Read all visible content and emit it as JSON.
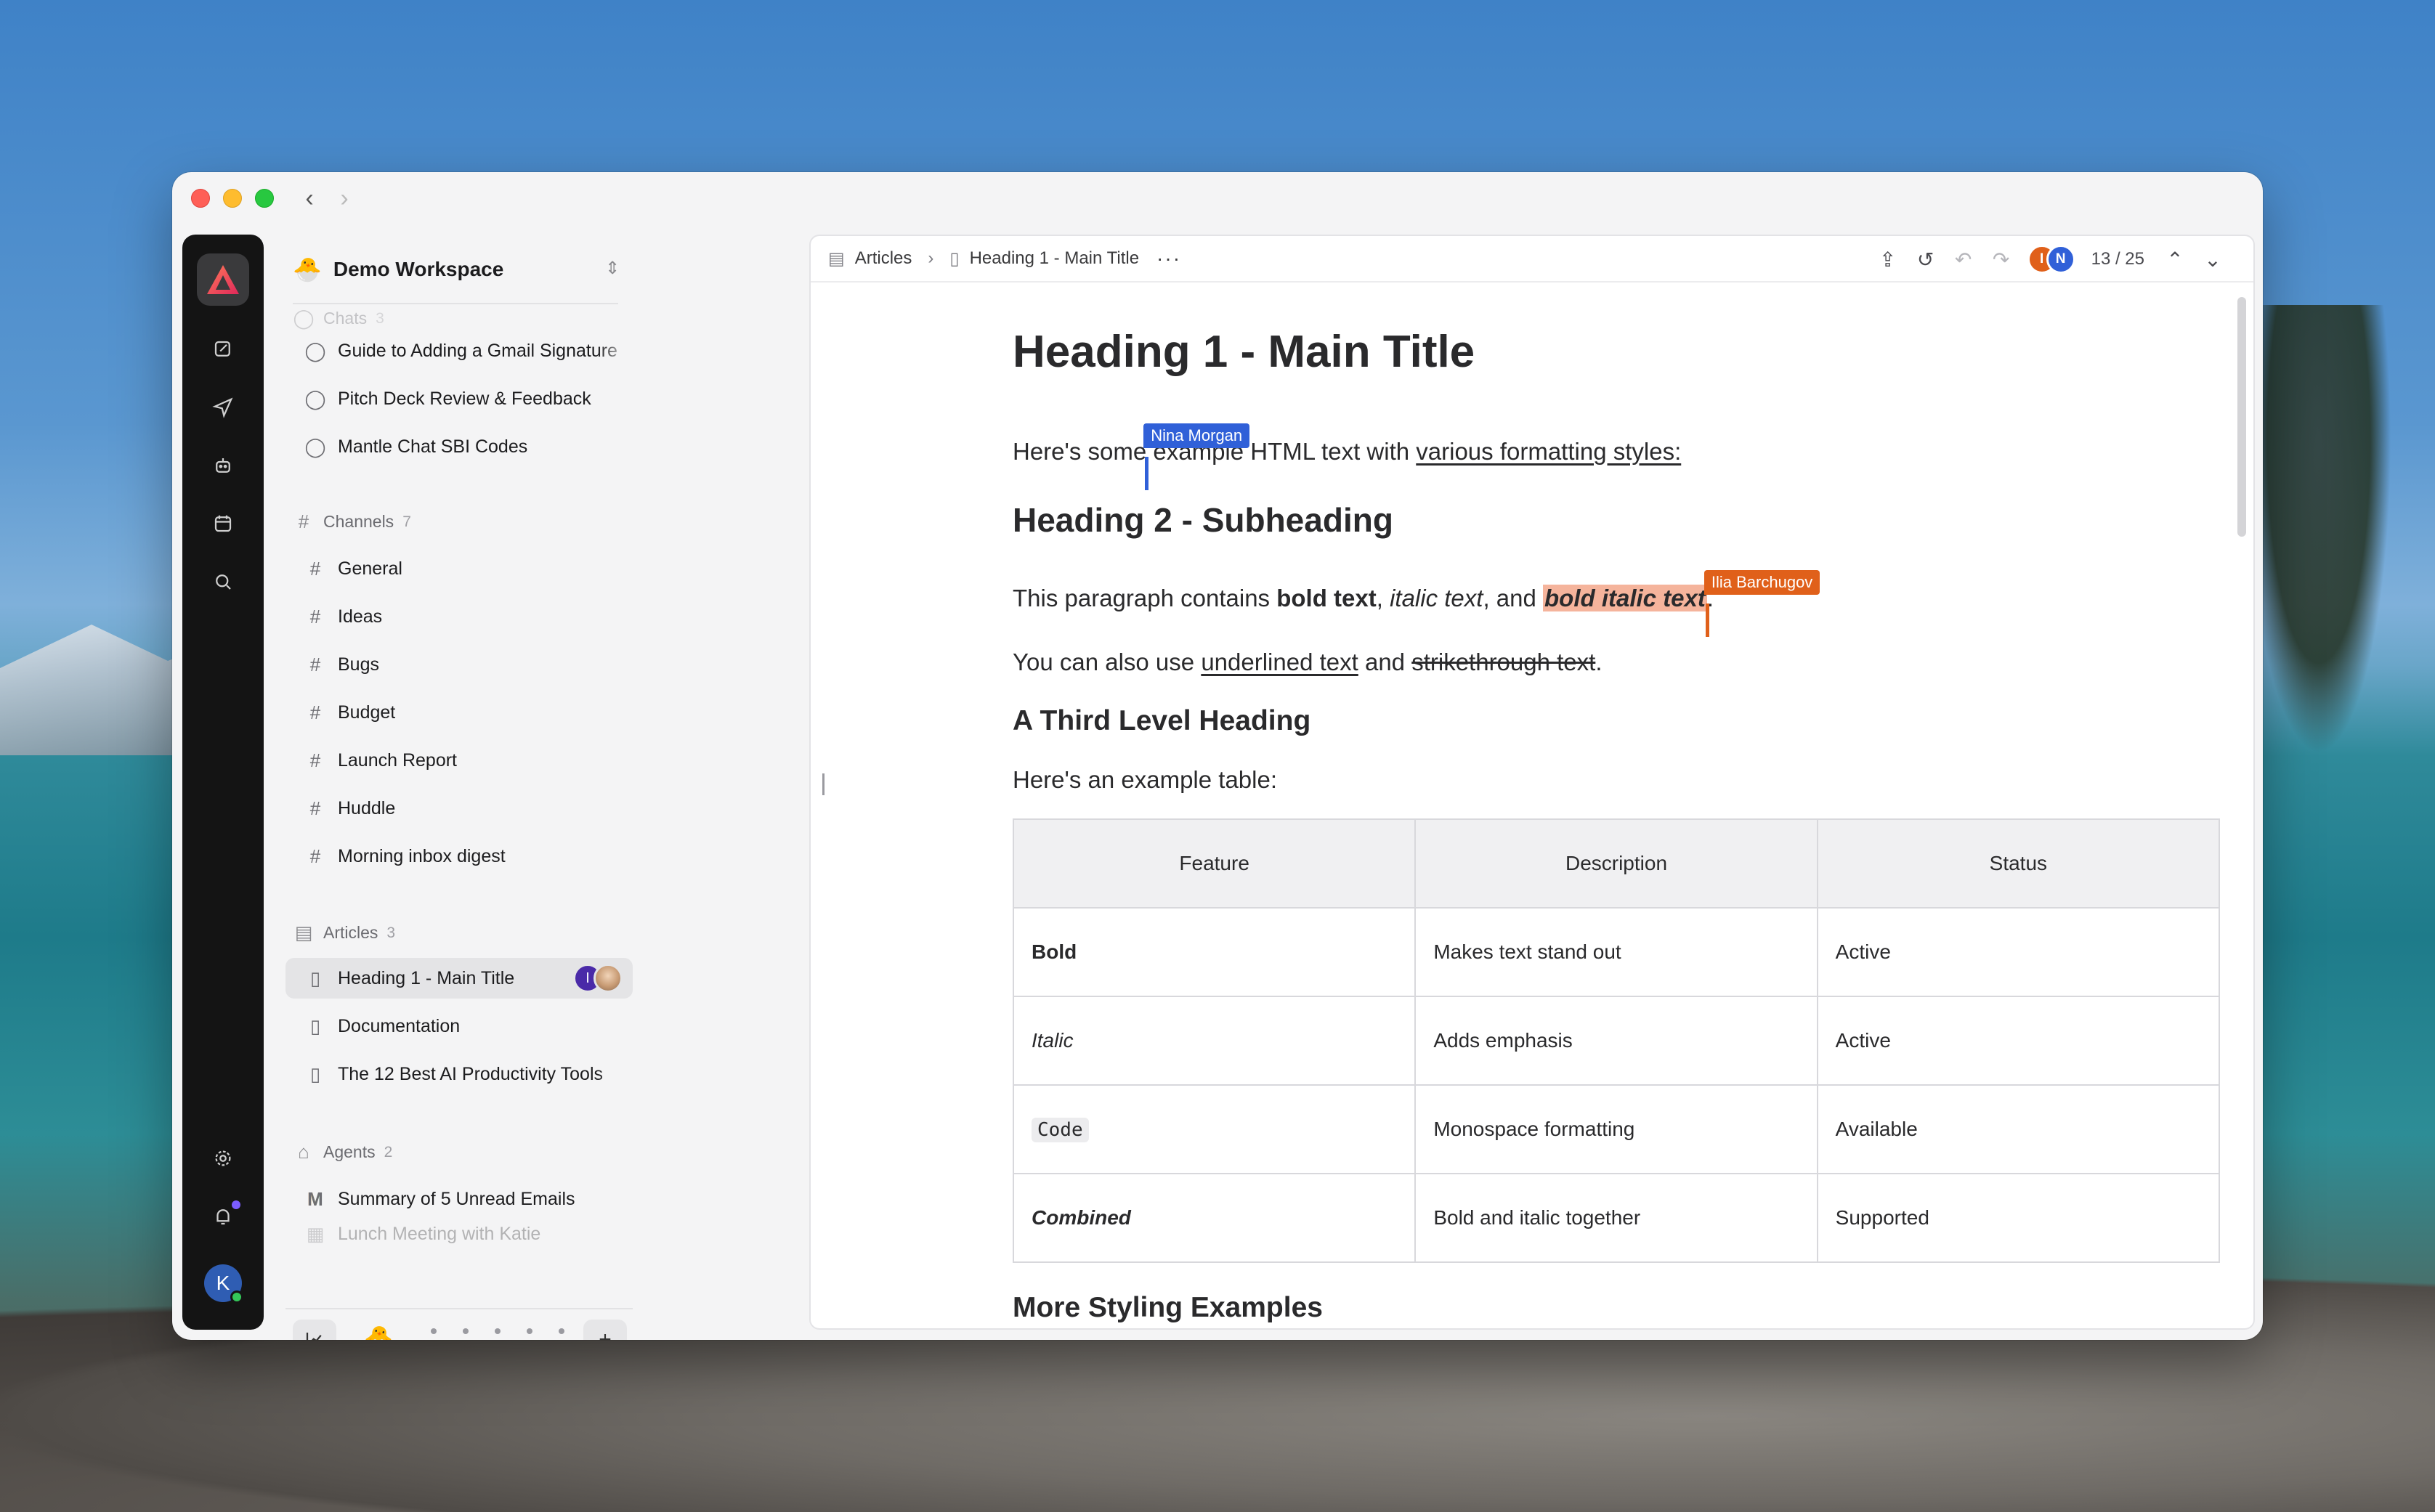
{
  "window": {
    "back_icon": "chevron-left-icon",
    "forward_icon": "chevron-right-icon"
  },
  "workspace": {
    "emoji": "🐣",
    "name": "Demo Workspace"
  },
  "sections": {
    "chats": {
      "label": "Chats",
      "count": "3",
      "items": [
        "Guide to Adding a Gmail Signature",
        "Pitch Deck Review & Feedback",
        "Mantle Chat SBI Codes"
      ]
    },
    "channels": {
      "label": "Channels",
      "count": "7",
      "items": [
        "General",
        "Ideas",
        "Bugs",
        "Budget",
        "Launch Report",
        "Huddle",
        "Morning inbox digest"
      ]
    },
    "articles": {
      "label": "Articles",
      "count": "3",
      "items": [
        "Heading 1 - Main Title",
        "Documentation",
        "The 12 Best AI Productivity Tools"
      ]
    },
    "agents": {
      "label": "Agents",
      "count": "2",
      "items": [
        "Summary of 5 Unread Emails",
        "Lunch Meeting with Katie"
      ]
    }
  },
  "user": {
    "initial": "K"
  },
  "article_presence": {
    "initial": "I"
  },
  "breadcrumb": {
    "root": "Articles",
    "current": "Heading 1 - Main Title"
  },
  "toolbar": {
    "presence_1": "I",
    "presence_2": "N",
    "page_count": "13 / 25"
  },
  "doc": {
    "h1": "Heading 1 - Main Title",
    "p1_a": "Here's some",
    "p1_b": " example HTML text with ",
    "p1_link": "various formatting styles:",
    "cursor_1": "Nina Morgan",
    "h2": "Heading 2 - Subheading",
    "p2_a": "This paragraph contains ",
    "p2_bold": "bold text",
    "p2_b": ", ",
    "p2_italic": "italic text",
    "p2_c": ", and ",
    "p2_bi": "bold italic text",
    "p2_d": ".",
    "cursor_2": "Ilia Barchugov",
    "p3_a": "You can also use ",
    "p3_u": "underlined text",
    "p3_b": " and ",
    "p3_s": "strikethrough text",
    "p3_c": ".",
    "h3": "A Third Level Heading",
    "p4": "Here's an example table:",
    "table": {
      "headers": [
        "Feature",
        "Description",
        "Status"
      ],
      "rows": [
        [
          "Bold",
          "Makes text stand out",
          "Active"
        ],
        [
          "Italic",
          "Adds emphasis",
          "Active"
        ],
        [
          "Code",
          "Monospace formatting",
          "Available"
        ],
        [
          "Combined",
          "Bold and italic together",
          "Supported"
        ]
      ]
    },
    "h2b": "More Styling Examples"
  },
  "colors": {
    "accent": "#3060d8",
    "collaborator_2": "#e0601a",
    "highlight": "#f5b49c"
  }
}
